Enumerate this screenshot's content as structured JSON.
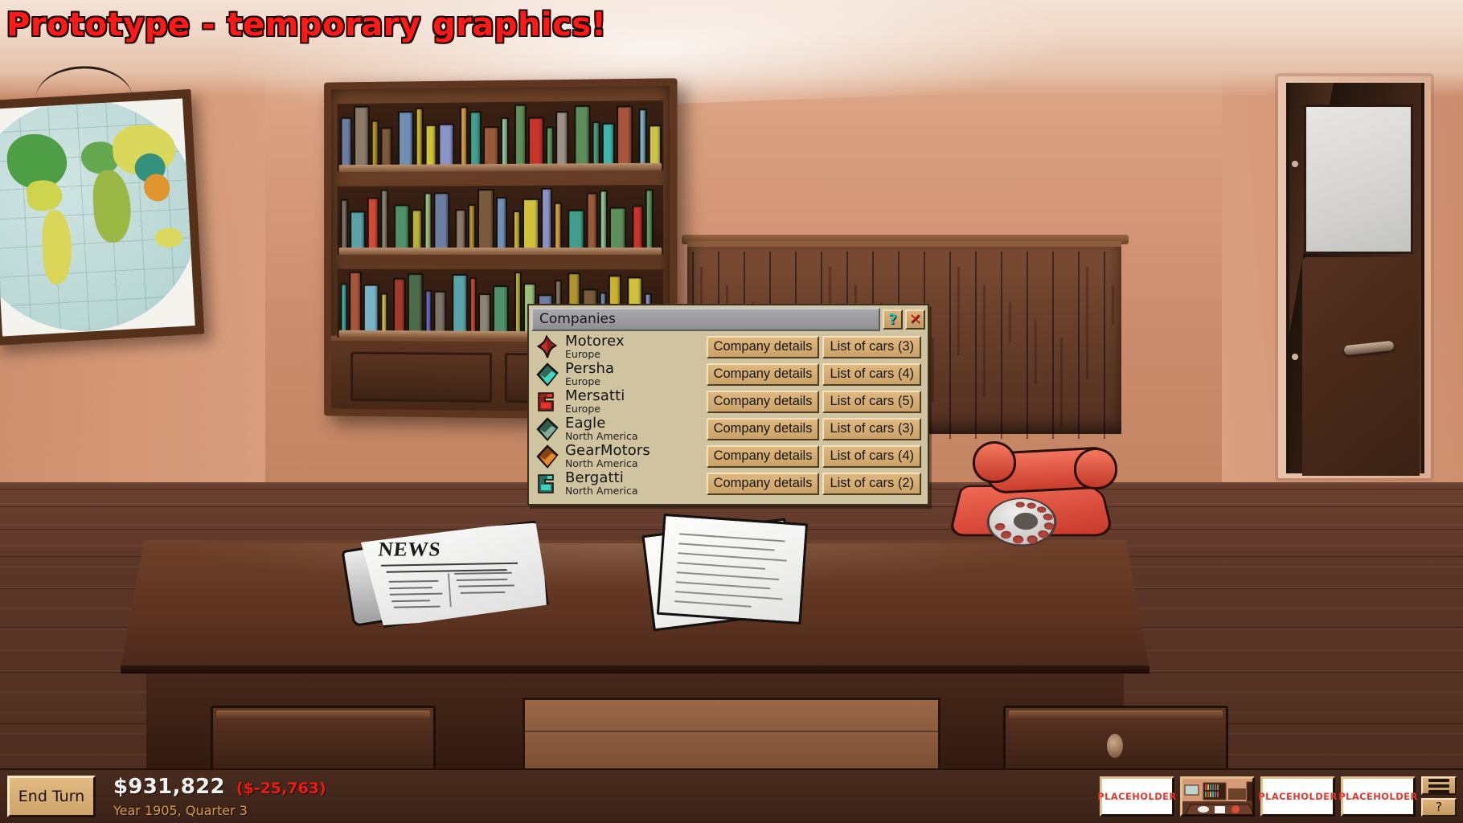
{
  "banner": {
    "text": "Prototype - temporary graphics!",
    "color": "#ff1a17"
  },
  "window": {
    "title": "Companies",
    "help_label": "?",
    "close_label": "✕",
    "companies": [
      {
        "name": "Motorex",
        "region": "Europe",
        "logo": "motorex-logo-icon",
        "logo_colors": [
          "#8f1d1d",
          "#c4302c"
        ],
        "details_label": "Company details",
        "cars_label": "List of cars (3)",
        "car_count": 3
      },
      {
        "name": "Persha",
        "region": "Europe",
        "logo": "persha-logo-icon",
        "logo_colors": [
          "#2e6b5c",
          "#3fd7bd"
        ],
        "details_label": "Company details",
        "cars_label": "List of cars (4)",
        "car_count": 4
      },
      {
        "name": "Mersatti",
        "region": "Europe",
        "logo": "mersatti-logo-icon",
        "logo_colors": [
          "#8b2420",
          "#e8322b"
        ],
        "details_label": "Company details",
        "cars_label": "List of cars (5)",
        "car_count": 5
      },
      {
        "name": "Eagle",
        "region": "North America",
        "logo": "eagle-logo-icon",
        "logo_colors": [
          "#2f5a4c",
          "#7fae9c"
        ],
        "details_label": "Company details",
        "cars_label": "List of cars (3)",
        "car_count": 3
      },
      {
        "name": "GearMotors",
        "region": "North America",
        "logo": "gearmotors-logo-icon",
        "logo_colors": [
          "#8a4410",
          "#e8892a"
        ],
        "details_label": "Company details",
        "cars_label": "List of cars (4)",
        "car_count": 4
      },
      {
        "name": "Bergatti",
        "region": "North America",
        "logo": "bergatti-logo-icon",
        "logo_colors": [
          "#2c6a62",
          "#3fd2c0"
        ],
        "details_label": "Company details",
        "cars_label": "List of cars (2)",
        "car_count": 2
      }
    ]
  },
  "status_bar": {
    "end_turn_label": "End Turn",
    "cash": "$931,822",
    "cash_delta": "($-25,763)",
    "date": "Year 1905, Quarter 3",
    "cash_color": "#f2f2f2",
    "delta_color": "#ee1b14",
    "date_color": "#d79a4e",
    "buttons": [
      {
        "label": "PLACEHOLDER",
        "name": "placeholder-button-1"
      },
      {
        "label": "",
        "name": "office-view-button"
      },
      {
        "label": "PLACEHOLDER",
        "name": "placeholder-button-2"
      },
      {
        "label": "PLACEHOLDER",
        "name": "placeholder-button-3"
      }
    ],
    "menu_icon": "hamburger-menu-icon",
    "help_label": "?"
  },
  "scene": {
    "newspaper_headline": "NEWS",
    "objects": [
      "world-map",
      "bookshelf",
      "desk",
      "newspaper",
      "papers",
      "rotary-telephone",
      "door"
    ]
  }
}
